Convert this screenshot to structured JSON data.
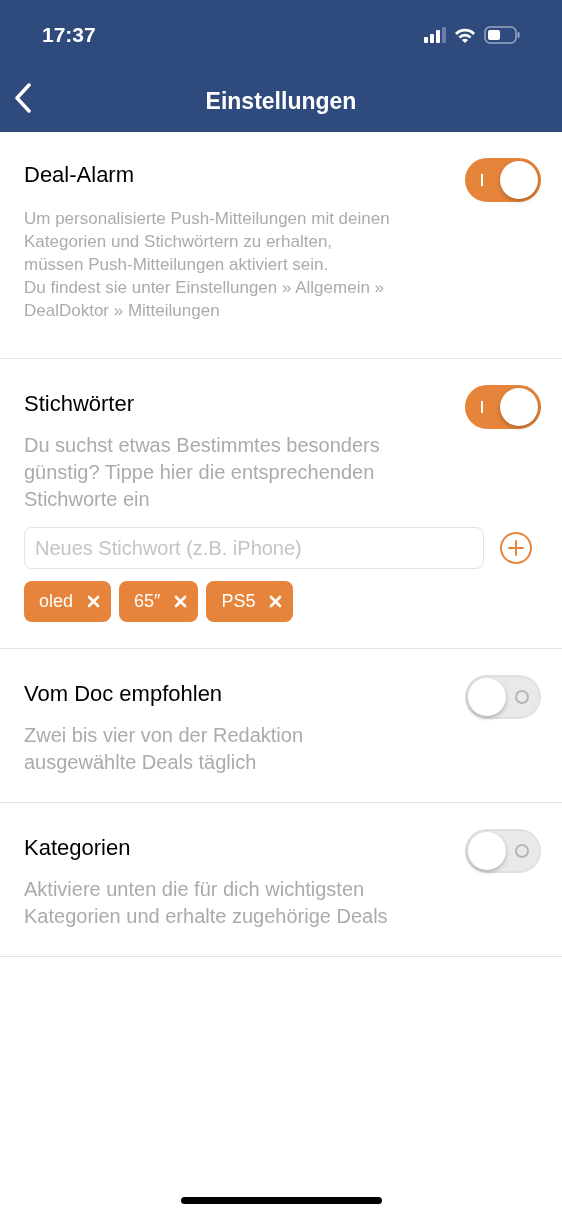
{
  "status_bar": {
    "time": "17:37"
  },
  "nav": {
    "title": "Einstellungen"
  },
  "sections": [
    {
      "kind": "note",
      "title": "Deal-Alarm",
      "on": true,
      "description": "Um personalisierte Push-Mitteilungen mit deinen\nKategorien und Stichwörtern zu erhalten,\nmüssen Push-Mitteilungen aktiviert sein.\nDu findest sie unter Einstellungen » Allgemein »\nDealDoktor » Mitteilungen"
    },
    {
      "kind": "keywords",
      "title": "Stichwörter",
      "on": true,
      "description": "Du suchst etwas Bestimmtes besonders\ngünstig? Tippe hier die entsprechenden\nStichworte ein",
      "placeholder": "Neues Stichwort (z.B. iPhone)",
      "tags": [
        "oled",
        "65″",
        "PS5"
      ]
    },
    {
      "kind": "plain",
      "title": "Vom Doc empfohlen",
      "on": false,
      "description": "Zwei bis vier von der Redaktion\nausgewählte Deals täglich"
    },
    {
      "kind": "plain",
      "title": "Kategorien",
      "on": false,
      "description": "Aktiviere unten die für dich wichtigsten\nKategorien und erhalte zugehörige Deals"
    }
  ]
}
